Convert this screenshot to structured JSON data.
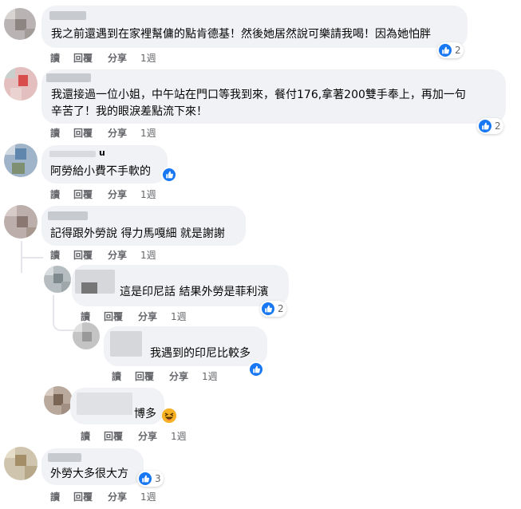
{
  "actions": {
    "read": "讀",
    "reply": "回覆",
    "share": "分享"
  },
  "comments": [
    {
      "text": "我之前還遇到在家裡幫傭的點肯德基！然後她居然說可樂請我喝！因為她怕胖",
      "time": "1週",
      "like_count": "2"
    },
    {
      "text_line1": "我還接過一位小姐，中午站在門口等我到來，餐付176,拿著200雙手奉上，再加一句",
      "text_line2": "辛苦了！我的眼淚差點流下來！",
      "time": "1週",
      "like_count": "2"
    },
    {
      "name_partial": "u",
      "text": "阿勞給小費不手軟的",
      "time": "1週"
    },
    {
      "text": "記得跟外勞說 得力馬嘎細 就是謝謝",
      "time": "1週"
    },
    {
      "text": "這是印尼話 結果外勞是菲利濱",
      "time": "1週",
      "like_count": "2"
    },
    {
      "text": "我遇到的印尼比較多",
      "time": "1週"
    },
    {
      "text": "博多",
      "time": "1週"
    },
    {
      "text": "外勞大多很大方",
      "time": "1週",
      "like_count": "3"
    }
  ],
  "colors": {
    "bubble": "#f0f2f5",
    "like": "#1877f2",
    "muted": "#65676b",
    "text": "#050505"
  },
  "icons": [
    "like-icon",
    "haha-icon"
  ]
}
